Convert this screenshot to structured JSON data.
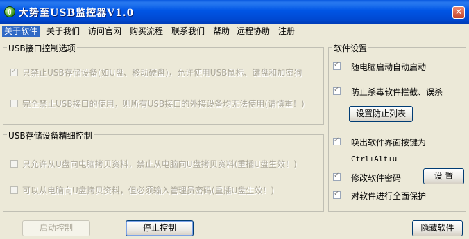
{
  "window": {
    "title": "大势至USB监控器V1.0"
  },
  "menu": [
    {
      "label": "关于软件",
      "active": true
    },
    {
      "label": "关于我们"
    },
    {
      "label": "访问官网"
    },
    {
      "label": "购买流程"
    },
    {
      "label": "联系我们"
    },
    {
      "label": "帮助"
    },
    {
      "label": "远程协助"
    },
    {
      "label": "注册"
    }
  ],
  "usb_interface_group": {
    "title": "USB接口控制选项",
    "options": [
      {
        "label": "只禁止USB存储设备(如U盘、移动硬盘)，允许使用USB鼠标、键盘和加密狗",
        "checked": true,
        "enabled": false
      },
      {
        "label": "完全禁止USB接口的使用，则所有USB接口的外接设备均无法使用(请慎重！)",
        "checked": false,
        "enabled": false
      }
    ]
  },
  "usb_storage_group": {
    "title": "USB存储设备精细控制",
    "options": [
      {
        "label": "只允许从U盘向电脑拷贝资料，禁止从电脑向U盘拷贝资料(重插U盘生效！)",
        "checked": false,
        "enabled": false
      },
      {
        "label": "可以从电脑向U盘拷贝资料，但必须输入管理员密码(重插U盘生效！)",
        "checked": false,
        "enabled": false
      }
    ]
  },
  "software_settings": {
    "title": "软件设置",
    "autostart": {
      "label": "随电脑启动自动启动",
      "checked": true
    },
    "anti_kill": {
      "label": "防止杀毒软件拦截、误杀",
      "checked": true
    },
    "set_list_button": "设置防止列表",
    "hotkey": {
      "label": "唤出软件界面按键为",
      "checked": true
    },
    "hotkey_value": "Ctrl+Alt+u",
    "change_password": {
      "label": "修改软件密码",
      "checked": true
    },
    "set_button": "设 置",
    "full_protect": {
      "label": "对软件进行全面保护",
      "checked": true
    }
  },
  "bottom_buttons": {
    "start": "启动控制",
    "stop": "停止控制",
    "hide": "隐藏软件"
  }
}
